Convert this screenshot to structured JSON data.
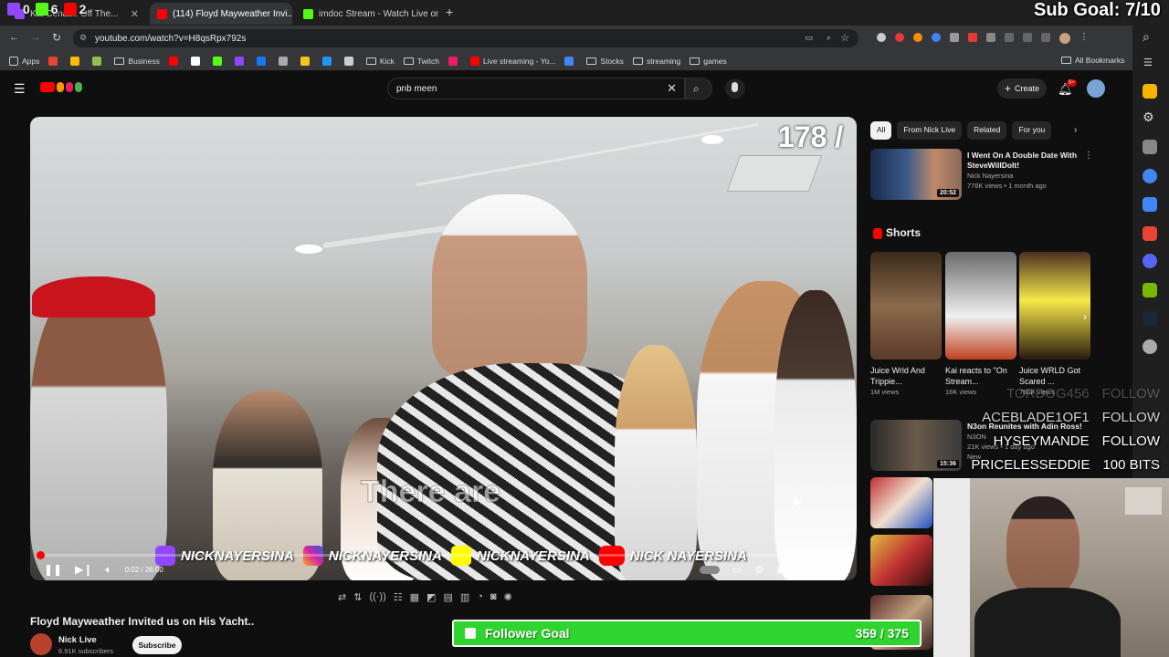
{
  "stream_overlay": {
    "top_counters": [
      {
        "icon": "twitch-icon",
        "value": "0"
      },
      {
        "icon": "kick-icon",
        "value": "6"
      },
      {
        "icon": "youtube-icon",
        "value": "2"
      }
    ],
    "sub_goal": "Sub Goal: 7/10",
    "follower_goal_label": "Follower Goal",
    "follower_goal_value": "359 / 375",
    "follower_goal_progress": 0.957,
    "follower_goal_color": "#2fd42f",
    "alerts": [
      {
        "name": "TORDOG456",
        "action": "FOLLOW"
      },
      {
        "name": "ACEBLADE1OF1",
        "action": "FOLLOW"
      },
      {
        "name": "HYSEYMANDE",
        "action": "FOLLOW"
      },
      {
        "name": "PRICELESSEDDIE",
        "action": "100 BITS"
      }
    ]
  },
  "browser": {
    "tabs": [
      {
        "title": "Kai Cenat... Off The...",
        "active": false
      },
      {
        "title": "(114) Floyd Mayweather Invi...",
        "active": true
      },
      {
        "title": "imdoc Stream - Watch Live on K...",
        "active": false
      }
    ],
    "url": "youtube.com/watch?v=H8qsRpx792s",
    "bookmarks": [
      {
        "label": "Apps",
        "type": "apps"
      },
      {
        "label": "",
        "type": "icon",
        "color": "#ea4335"
      },
      {
        "label": "",
        "type": "icon",
        "color": "#fbbc05"
      },
      {
        "label": "",
        "type": "icon",
        "color": "#8bc34a"
      },
      {
        "label": "Business",
        "type": "folder"
      },
      {
        "label": "",
        "type": "icon",
        "color": "#ff0000"
      },
      {
        "label": "",
        "type": "icon",
        "color": "#ffffff"
      },
      {
        "label": "",
        "type": "icon",
        "color": "#53fc18"
      },
      {
        "label": "",
        "type": "icon",
        "color": "#9146ff"
      },
      {
        "label": "",
        "type": "icon",
        "color": "#1877f2"
      },
      {
        "label": "",
        "type": "icon",
        "color": "#aaaaaa"
      },
      {
        "label": "",
        "type": "icon",
        "color": "#f0c419"
      },
      {
        "label": "",
        "type": "icon",
        "color": "#2196f3"
      },
      {
        "label": "",
        "type": "icon",
        "color": "#cccccc"
      },
      {
        "label": "Kick",
        "type": "folder"
      },
      {
        "label": "Twitch",
        "type": "folder"
      },
      {
        "label": "",
        "type": "icon",
        "color": "#e91e63"
      },
      {
        "label": "Live streaming - Yo...",
        "type": "icon",
        "color": "#ff0000"
      },
      {
        "label": "",
        "type": "icon",
        "color": "#4285f4"
      },
      {
        "label": "Stocks",
        "type": "folder"
      },
      {
        "label": "streaming",
        "type": "folder"
      },
      {
        "label": "games",
        "type": "folder"
      }
    ],
    "all_bookmarks": "All Bookmarks"
  },
  "youtube": {
    "search_value": "pnb meen",
    "create_label": "Create",
    "notification_badge": "9+",
    "player": {
      "counter": "178 /",
      "caption": "There are",
      "time": "0:02 / 26:00",
      "progress": 0.0013,
      "socials": [
        {
          "icon": "twitch-icon",
          "handle": "NICKNAYERSINA",
          "color": "#9146ff"
        },
        {
          "icon": "instagram-icon",
          "handle": "NICKNAYERSINA",
          "color": "#d6249f"
        },
        {
          "icon": "snapchat-icon",
          "handle": "NICKNAYERSINA",
          "color": "#fffc00"
        },
        {
          "icon": "youtube-icon",
          "handle": "NICK NAYERSINA",
          "color": "#ff0000"
        }
      ]
    },
    "video_title": "Floyd Mayweather Invited us on His Yacht..",
    "channel": {
      "name": "Nick Live",
      "subscribers": "6.91K subscribers",
      "subscribe_label": "Subscribe"
    },
    "chips": [
      {
        "label": "All",
        "active": true
      },
      {
        "label": "From Nick Live",
        "active": false
      },
      {
        "label": "Related",
        "active": false
      },
      {
        "label": "For you",
        "active": false
      }
    ],
    "recommendations": [
      {
        "title": "I Went On A Double Date With SteveWillDoIt!",
        "channel": "Nick Nayersina",
        "meta": "776K views • 1 month ago",
        "duration": "20:52"
      }
    ],
    "shorts_heading": "Shorts",
    "shorts": [
      {
        "title": "Juice Wrld And Trippie...",
        "views": "1M views"
      },
      {
        "title": "Kai reacts to \"On Stream...",
        "views": "16K views"
      },
      {
        "title": "Juice WRLD Got Scared ...",
        "views": "760K views"
      }
    ],
    "more_recs": [
      {
        "title": "N3on Reunites with Adin Ross!",
        "channel": "N3ON",
        "meta": "21K views • 1 day ago",
        "extra": "New",
        "duration": "15:36"
      }
    ]
  }
}
